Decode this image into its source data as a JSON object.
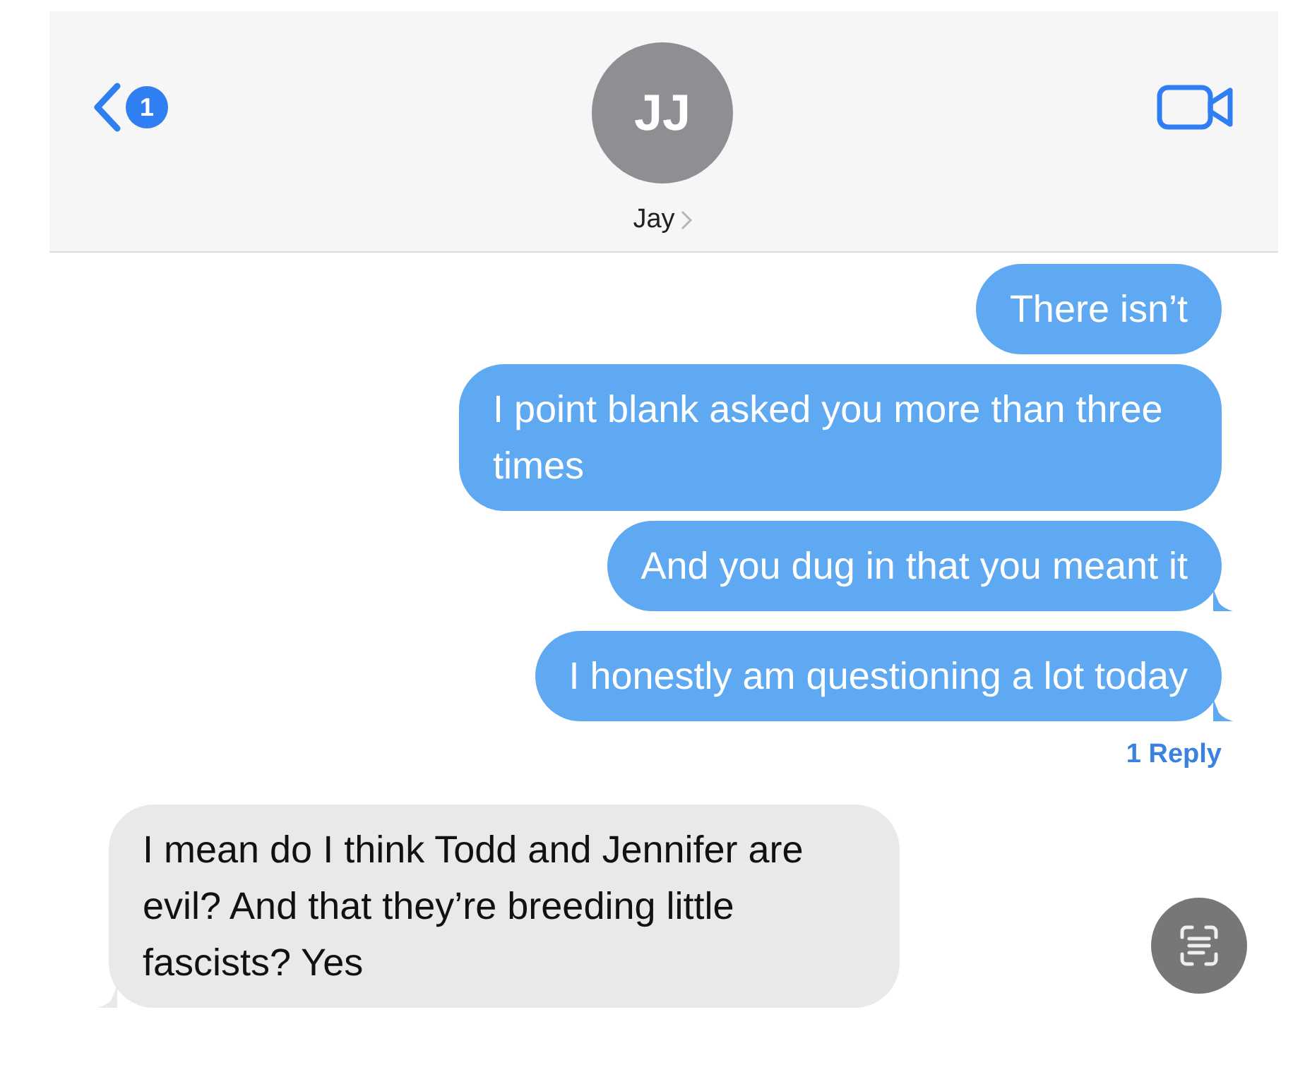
{
  "header": {
    "back_badge": "1",
    "avatar_initials": "JJ",
    "contact_name": "Jay"
  },
  "messages": [
    {
      "kind": "outgoing",
      "text": "There isn’t",
      "tail": false
    },
    {
      "kind": "outgoing",
      "text": "I point blank asked you more than three times",
      "tail": false
    },
    {
      "kind": "outgoing",
      "text": "And you dug in that you meant it",
      "tail": true
    },
    {
      "kind": "outgoing",
      "text": "I honestly am questioning a lot today",
      "tail": true,
      "reply_count": "1 Reply"
    },
    {
      "kind": "incoming",
      "text": "I mean do I think Todd and Jennifer are evil? And that they’re breeding little fascists? Yes",
      "tail": true
    }
  ]
}
